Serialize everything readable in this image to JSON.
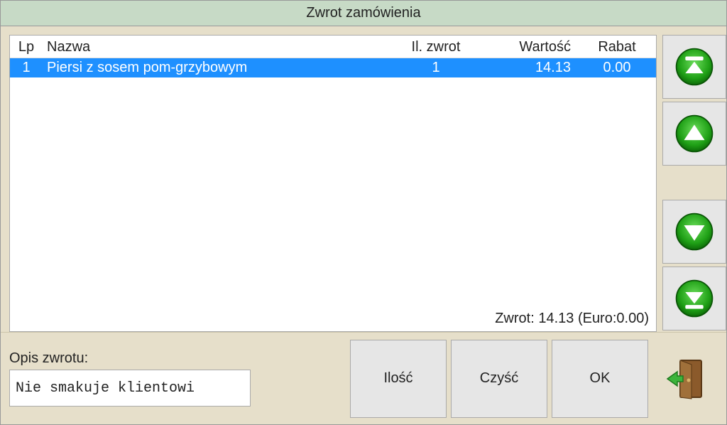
{
  "window": {
    "title": "Zwrot zamówienia"
  },
  "table": {
    "headers": {
      "lp": "Lp",
      "name": "Nazwa",
      "qty": "Il. zwrot",
      "value": "Wartość",
      "rebate": "Rabat"
    },
    "rows": [
      {
        "lp": "1",
        "name": "Piersi z sosem pom-grzybowym",
        "qty": "1",
        "value": "14.13",
        "rebate": "0.00",
        "selected": true
      }
    ],
    "summary": "Zwrot: 14.13 (Euro:0.00)"
  },
  "description": {
    "label": "Opis zwrotu:",
    "value": "Nie smakuje klientowi"
  },
  "buttons": {
    "quantity": "Ilość",
    "clear": "Czyść",
    "ok": "OK"
  },
  "icons": {
    "scroll_top": "scroll-top-icon",
    "scroll_up": "scroll-up-icon",
    "scroll_down": "scroll-down-icon",
    "scroll_bottom": "scroll-bottom-icon",
    "exit": "exit-door-icon"
  }
}
